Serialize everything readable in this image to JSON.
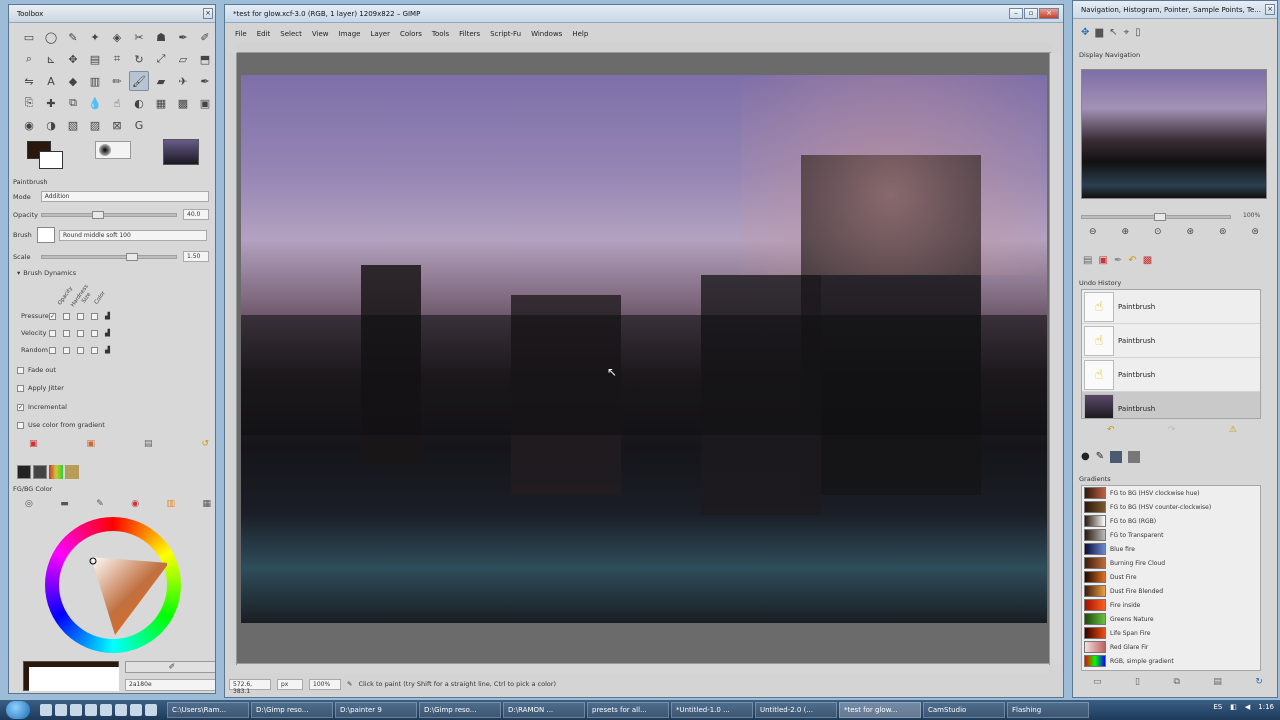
{
  "toolbox": {
    "title": "Toolbox",
    "tools_row1": [
      "rect-select",
      "ellipse-select",
      "free-select",
      "fuzzy-select",
      "color-select",
      "scissors",
      "foreground-select",
      "paths",
      "color-picker"
    ],
    "tools_row2": [
      "zoom",
      "measure",
      "move",
      "align",
      "crop",
      "rotate",
      "scale",
      "shear",
      "perspective"
    ],
    "tools_row3": [
      "flip",
      "cage",
      "text",
      "bucket-fill",
      "blend",
      "pencil",
      "paintbrush",
      "eraser",
      "airbrush"
    ],
    "tools_row4": [
      "ink",
      "clone",
      "perspective-clone",
      "heal",
      "smudge",
      "blur",
      "dodge-burn",
      "gegl",
      "unused"
    ],
    "tools_row5": [
      "dodge",
      "blur",
      "smudge",
      "curve",
      "color-balance",
      "g-icon"
    ],
    "paintbrush": {
      "section": "Paintbrush",
      "mode_label": "Mode",
      "mode_value": "Addition",
      "opacity_label": "Opacity",
      "opacity_value": "40.0",
      "brush_label": "Brush",
      "brush_value": "Round  middle soft 100",
      "scale_label": "Scale",
      "scale_value": "1.50",
      "dynamics_label": "Brush Dynamics",
      "dyn_columns": [
        "Opacity",
        "Hardness",
        "Size",
        "Color"
      ],
      "dyn_rows": [
        "Pressure",
        "Velocity",
        "Random"
      ],
      "fade_out": "Fade out",
      "apply_jitter": "Apply Jitter",
      "incremental": "Incremental",
      "use_color_gradient": "Use color from gradient"
    },
    "fgbg": {
      "section": "FG/BG Color",
      "hex_value": "2a180e"
    }
  },
  "gimp": {
    "title": "*test for glow.xcf-3.0 (RGB, 1 layer) 1209x822 – GIMP",
    "menu": [
      "File",
      "Edit",
      "Select",
      "View",
      "Image",
      "Layer",
      "Colors",
      "Tools",
      "Filters",
      "Script-Fu",
      "Windows",
      "Help"
    ],
    "status": {
      "coords": "572.6, 383.1",
      "unit": "px",
      "zoom": "100%",
      "message": "Click to paint (try Shift for a straight line, Ctrl to pick a color)"
    }
  },
  "dock": {
    "title": "Navigation, Histogram, Pointer, Sample Points, Te...",
    "display_nav": "Display Navigation",
    "nav_zoom": "100%",
    "undo_title": "Undo History",
    "undo_items": [
      "Paintbrush",
      "Paintbrush",
      "Paintbrush",
      "Paintbrush"
    ],
    "gradients_title": "Gradients",
    "gradients": [
      {
        "name": "FG to BG (HSV clockwise hue)",
        "color": "#8b5a3a"
      },
      {
        "name": "FG to BG (HSV counter-clockwise)",
        "color": "#6a4a2a"
      },
      {
        "name": "FG to BG (RGB)",
        "color": "#a08070"
      },
      {
        "name": "FG to Transparent",
        "color": "#7a6a5a"
      },
      {
        "name": "Blue fire",
        "color": "#2a3a6a"
      },
      {
        "name": "Burning Fire Cloud",
        "color": "#6a3a2a"
      },
      {
        "name": "Dust Fire",
        "color": "#b05a20"
      },
      {
        "name": "Dust Fire Blended",
        "color": "#c07030"
      },
      {
        "name": "Fire inside",
        "color": "#d03a10"
      },
      {
        "name": "Greens Nature",
        "color": "#3a8a2a"
      },
      {
        "name": "Life Span Fire",
        "color": "#c04010"
      },
      {
        "name": "Red Glare Fir",
        "color": "#c0a0a0"
      },
      {
        "name": "RGB, simple gradient",
        "color": "#30a050"
      }
    ]
  },
  "taskbar": {
    "tasks": [
      {
        "label": "C:\\Users\\Ram...",
        "active": false
      },
      {
        "label": "D:\\Gimp reso...",
        "active": false
      },
      {
        "label": "D:\\painter 9",
        "active": false
      },
      {
        "label": "D:\\Gimp reso...",
        "active": false
      },
      {
        "label": "D:\\RAMON ...",
        "active": false
      },
      {
        "label": "presets for all...",
        "active": false
      },
      {
        "label": "*Untitled-1.0 ...",
        "active": false
      },
      {
        "label": "Untitled-2.0 (...",
        "active": false
      },
      {
        "label": "*test for glow...",
        "active": true
      },
      {
        "label": "CamStudio",
        "active": false
      },
      {
        "label": "Flashing",
        "active": false
      }
    ],
    "lang": "ES",
    "time": "1:16"
  },
  "colors": {
    "fg": "#2a180e",
    "bg": "#ffffff",
    "canvas_bg": "#6b6b6b"
  }
}
